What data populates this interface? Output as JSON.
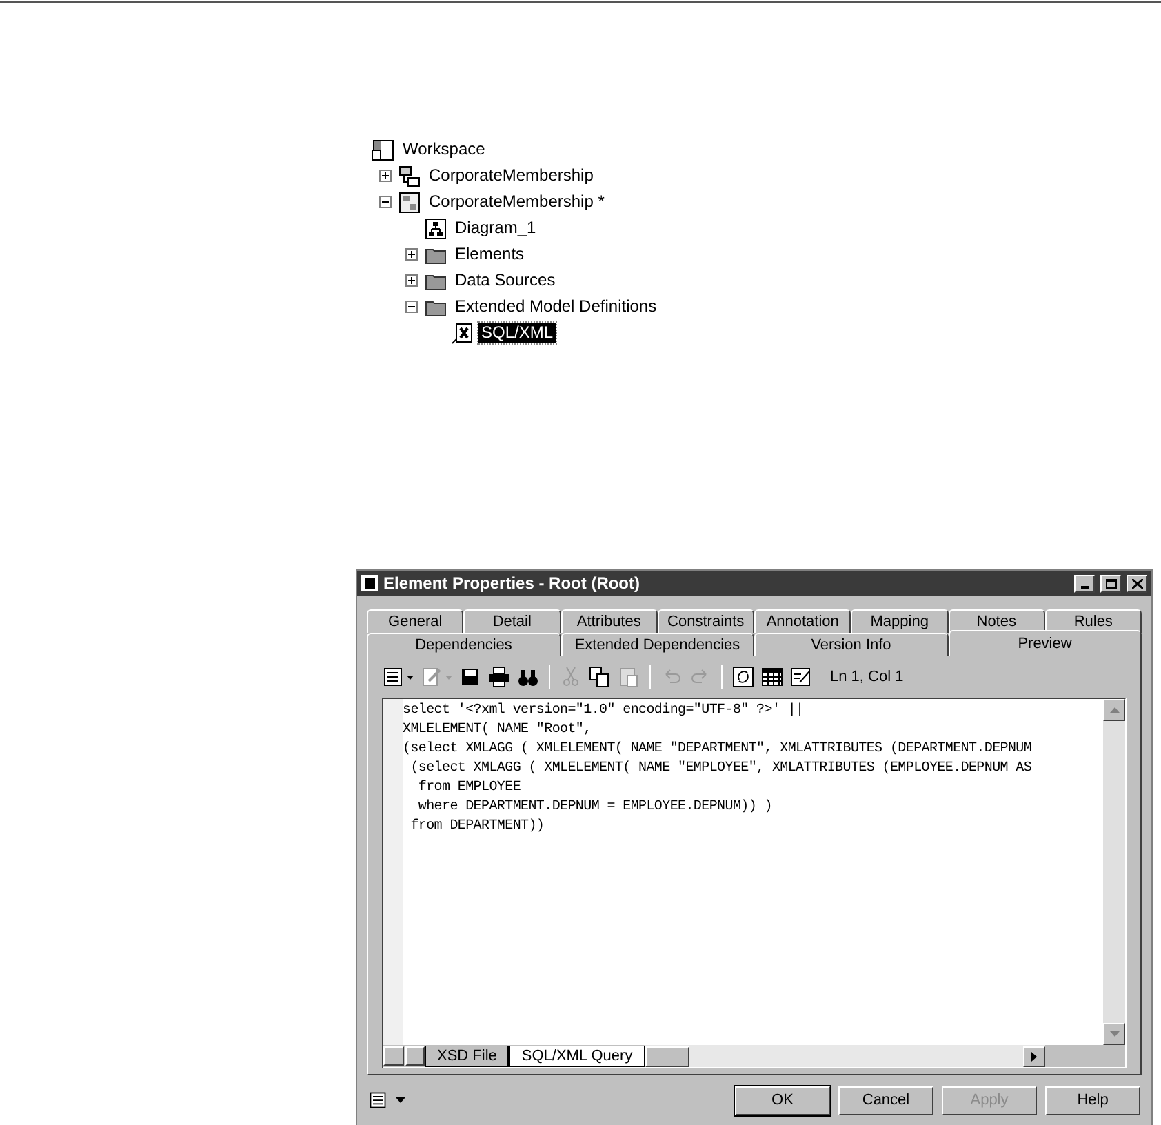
{
  "tree": {
    "label": "Workspace",
    "kind": "workspace",
    "children": [
      {
        "label": "CorporateMembership",
        "kind": "model",
        "expanded": false,
        "selected": false
      },
      {
        "label": "CorporateMembership *",
        "kind": "model2",
        "expanded": true,
        "selected": false,
        "children": [
          {
            "label": "Diagram_1",
            "kind": "diagram",
            "selected": false
          },
          {
            "label": "Elements",
            "kind": "folder",
            "expanded": false,
            "selected": false
          },
          {
            "label": "Data Sources",
            "kind": "folder",
            "expanded": false,
            "selected": false
          },
          {
            "label": "Extended Model Definitions",
            "kind": "folder",
            "expanded": true,
            "selected": false,
            "children": [
              {
                "label": "SQL/XML",
                "kind": "xem",
                "selected": true
              }
            ]
          }
        ]
      }
    ]
  },
  "dialog": {
    "title": "Element Properties - Root (Root)",
    "tab_rows": [
      [
        {
          "label": "General",
          "selected": false
        },
        {
          "label": "Detail",
          "selected": false
        },
        {
          "label": "Attributes",
          "selected": false
        },
        {
          "label": "Constraints",
          "selected": false
        },
        {
          "label": "Annotation",
          "selected": false
        },
        {
          "label": "Mapping",
          "selected": false
        },
        {
          "label": "Notes",
          "selected": false
        },
        {
          "label": "Rules",
          "selected": false
        }
      ],
      [
        {
          "label": "Dependencies",
          "selected": false
        },
        {
          "label": "Extended Dependencies",
          "selected": false
        },
        {
          "label": "Version Info",
          "selected": false
        },
        {
          "label": "Preview",
          "selected": true
        }
      ]
    ],
    "toolbar": [
      {
        "kind": "list",
        "disabled": false
      },
      {
        "kind": "edit",
        "disabled": true
      },
      {
        "kind": "save",
        "disabled": false
      },
      {
        "kind": "print",
        "disabled": false
      },
      {
        "kind": "find",
        "disabled": false
      },
      {
        "kind": "sep"
      },
      {
        "kind": "cut",
        "disabled": true
      },
      {
        "kind": "copy",
        "disabled": false
      },
      {
        "kind": "paste",
        "disabled": true
      },
      {
        "kind": "sep"
      },
      {
        "kind": "undo",
        "disabled": true
      },
      {
        "kind": "redo",
        "disabled": true
      },
      {
        "kind": "sep"
      },
      {
        "kind": "refresh",
        "disabled": false
      },
      {
        "kind": "grid",
        "disabled": false
      },
      {
        "kind": "form",
        "disabled": false
      }
    ],
    "cursor_position": "Ln 1, Col 1",
    "code_lines": [
      "select '<?xml version=\"1.0\" encoding=\"UTF-8\" ?>' ||",
      "XMLELEMENT( NAME \"Root\",",
      "(select XMLAGG ( XMLELEMENT( NAME \"DEPARTMENT\", XMLATTRIBUTES (DEPARTMENT.DEPNUM",
      " (select XMLAGG ( XMLELEMENT( NAME \"EMPLOYEE\", XMLATTRIBUTES (EMPLOYEE.DEPNUM AS",
      "  from EMPLOYEE",
      "  where DEPARTMENT.DEPNUM = EMPLOYEE.DEPNUM)) )",
      " from DEPARTMENT))"
    ],
    "sheet_tabs": [
      {
        "label": "XSD File",
        "selected": false
      },
      {
        "label": "SQL/XML Query",
        "selected": true
      }
    ],
    "buttons": [
      {
        "label": "OK",
        "disabled": false,
        "default": true
      },
      {
        "label": "Cancel",
        "disabled": false,
        "default": false
      },
      {
        "label": "Apply",
        "disabled": true,
        "default": false
      },
      {
        "label": "Help",
        "disabled": false,
        "default": false
      }
    ]
  }
}
